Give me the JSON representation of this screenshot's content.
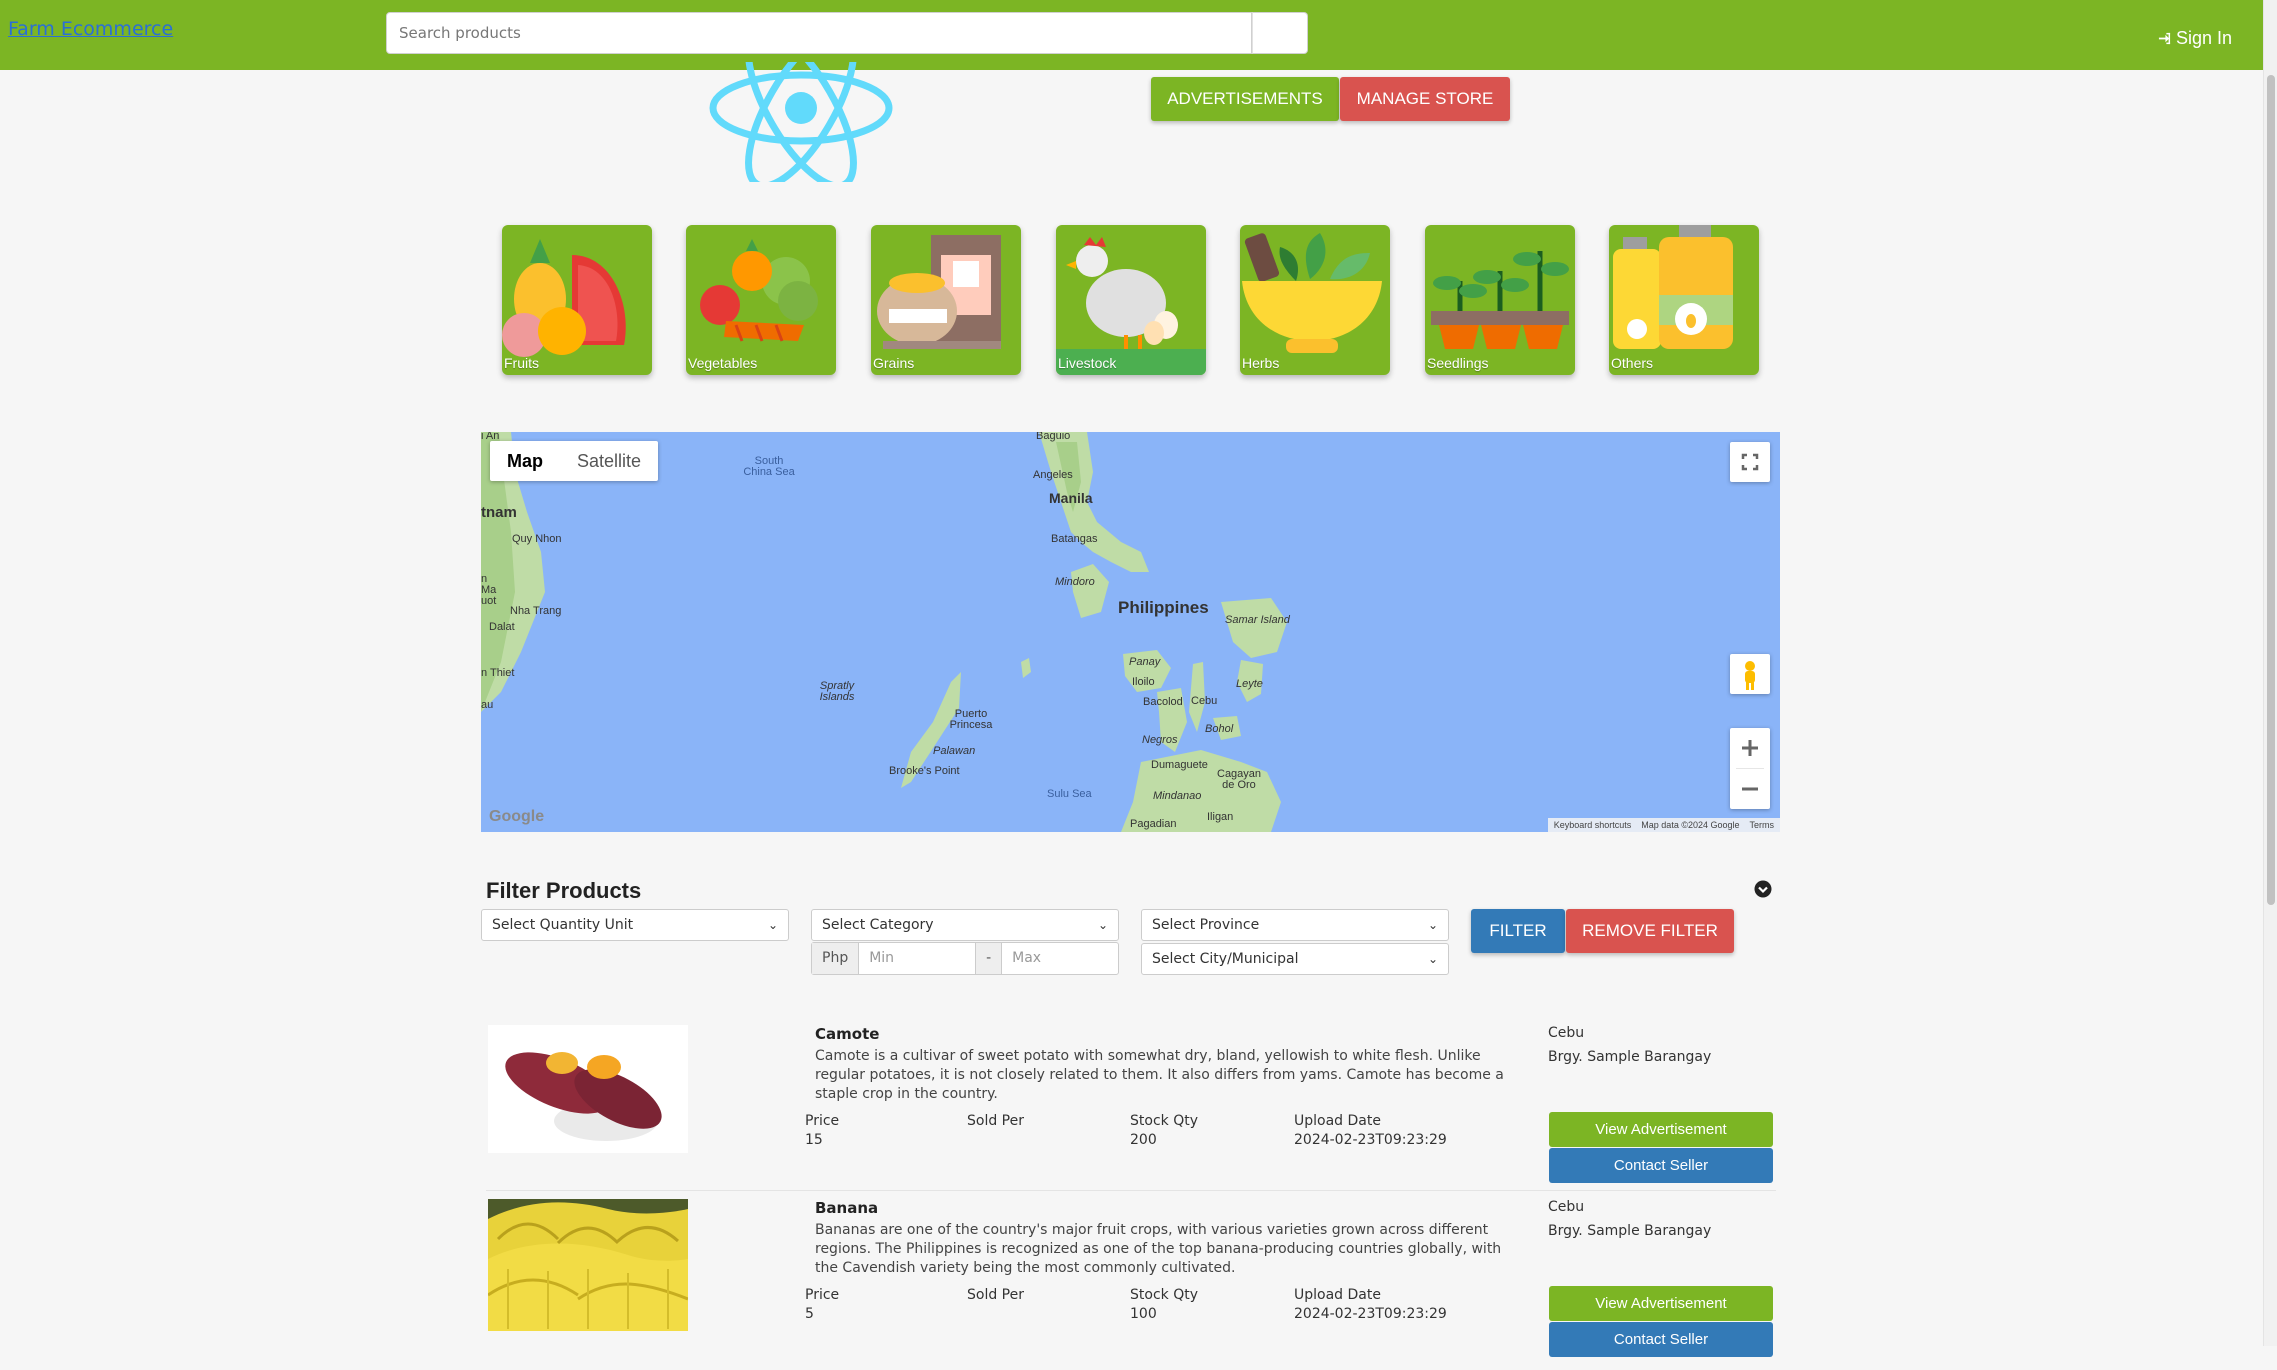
{
  "navbar": {
    "brand": "Farm Ecommerce",
    "search_placeholder": "Search products",
    "signin_icon": "sign-in-icon",
    "signin_label": "Sign In"
  },
  "header": {
    "advertisements_label": "ADVERTISEMENTS",
    "manage_store_label": "MANAGE STORE"
  },
  "categories": [
    {
      "label": "Fruits",
      "icon": "fruits-icon"
    },
    {
      "label": "Vegetables",
      "icon": "vegetables-icon"
    },
    {
      "label": "Grains",
      "icon": "grains-icon"
    },
    {
      "label": "Livestock",
      "icon": "livestock-icon"
    },
    {
      "label": "Herbs",
      "icon": "herbs-icon"
    },
    {
      "label": "Seedlings",
      "icon": "seedlings-icon"
    },
    {
      "label": "Others",
      "icon": "others-icon"
    }
  ],
  "map": {
    "type_map": "Map",
    "type_satellite": "Satellite",
    "labels": {
      "baguio": "Baguio",
      "angeles": "Angeles",
      "manila": "Manila",
      "batangas": "Batangas",
      "mindoro": "Mindoro",
      "philippines": "Philippines",
      "samar": "Samar Island",
      "panay": "Panay",
      "iloilo": "Iloilo",
      "bacolod": "Bacolod",
      "cebu": "Cebu",
      "leyte": "Leyte",
      "bohol": "Bohol",
      "negros": "Negros",
      "dumaguete": "Dumaguete",
      "cagayan": "Cagayan de Oro",
      "mindanao": "Mindanao",
      "iligan": "Iligan",
      "pagadian": "Pagadian",
      "sulu": "Sulu Sea",
      "puerto": "Puerto Princesa",
      "palawan": "Palawan",
      "brookes": "Brooke's Point",
      "spratly": "Spratly Islands",
      "southchina": "South China Sea",
      "vietnam": "tnam",
      "quynhon": "Quy Nhon",
      "nhatrang": "Nha Trang",
      "dalat": "Dalat",
      "phanthiet": "n Thiet",
      "buonmathuot": "n Ma uot",
      "hoian": "i An",
      "au": "au"
    },
    "attribution": {
      "shortcuts": "Keyboard shortcuts",
      "data": "Map data ©2024 Google",
      "terms": "Terms",
      "google": "Google"
    }
  },
  "filter": {
    "title": "Filter Products",
    "quantity_unit": "Select Quantity Unit",
    "category": "Select Category",
    "province": "Select Province",
    "city": "Select City/Municipal",
    "currency": "Php",
    "min_placeholder": "Min",
    "separator": "-",
    "max_placeholder": "Max",
    "filter_label": "FILTER",
    "remove_label": "REMOVE FILTER"
  },
  "product_labels": {
    "price": "Price",
    "sold_per": "Sold Per",
    "stock_qty": "Stock Qty",
    "upload_date": "Upload Date",
    "view": "View Advertisement",
    "contact": "Contact Seller"
  },
  "products": [
    {
      "name": "Camote",
      "description": "Camote is a cultivar of sweet potato with somewhat dry, bland, yellowish to white flesh. Unlike regular potatoes, it is not closely related to them. It also differs from yams. Camote has become a staple crop in the country.",
      "price": "15",
      "sold_per": "",
      "stock_qty": "200",
      "upload_date": "2024-02-23T09:23:29",
      "province": "Cebu",
      "barangay": "Brgy. Sample Barangay"
    },
    {
      "name": "Banana",
      "description": "Bananas are one of the country's major fruit crops, with various varieties grown across different regions. The Philippines is recognized as one of the top banana-producing countries globally, with the Cavendish variety being the most commonly cultivated.",
      "price": "5",
      "sold_per": "",
      "stock_qty": "100",
      "upload_date": "2024-02-23T09:23:29",
      "province": "Cebu",
      "barangay": "Brgy. Sample Barangay"
    }
  ],
  "colors": {
    "brand_green": "#7cb524",
    "danger_red": "#d9534f",
    "primary_blue": "#337ab7",
    "map_water": "#8ab4f8"
  }
}
